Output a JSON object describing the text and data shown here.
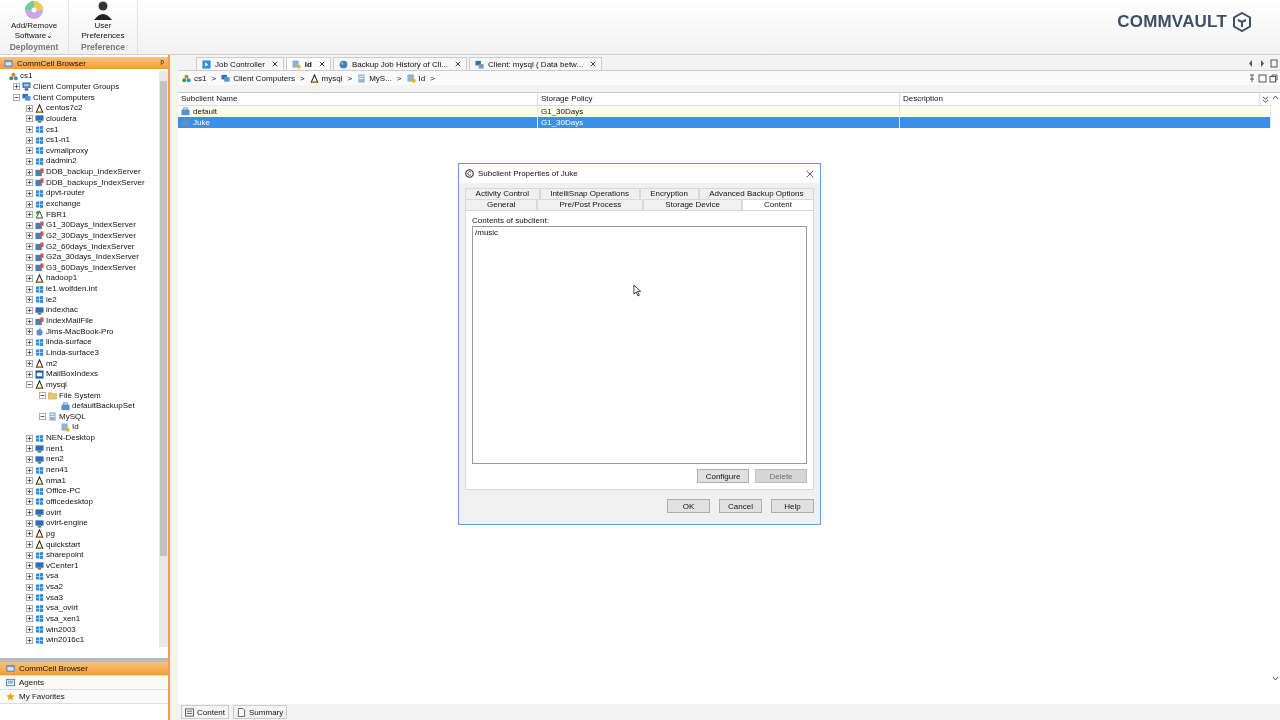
{
  "ribbon": {
    "buttons": [
      {
        "label": "Add/Remove",
        "label2": "Software",
        "caret": "⌄",
        "kind": "disc"
      },
      {
        "label": "User",
        "label2": "Preferences",
        "kind": "user"
      }
    ],
    "groups": [
      "Deployment",
      "Preference"
    ],
    "logo": "COMMVAULT"
  },
  "browser": {
    "title": "CommCell Browser",
    "pin": "ᵖ",
    "tree": [
      {
        "label": "cs1",
        "kind": "root",
        "children": [
          {
            "label": "Client Computer Groups",
            "kind": "groups",
            "expanded": false
          },
          {
            "label": "Client Computers",
            "kind": "computers",
            "expanded": true,
            "children": [
              {
                "label": "centos7c2",
                "kind": "linux",
                "expanded": false
              },
              {
                "label": "cloudera",
                "kind": "monitor",
                "expanded": false
              },
              {
                "label": "cs1",
                "kind": "windows",
                "expanded": false
              },
              {
                "label": "cs1-n1",
                "kind": "windows",
                "expanded": false
              },
              {
                "label": "cvmailproxy",
                "kind": "windows",
                "expanded": false
              },
              {
                "label": "dadmin2",
                "kind": "windows",
                "expanded": false
              },
              {
                "label": "DDB_backup_IndexServer",
                "kind": "server",
                "expanded": false
              },
              {
                "label": "DDB_backups_IndexServer",
                "kind": "server",
                "expanded": false
              },
              {
                "label": "dpvt-router",
                "kind": "windows",
                "expanded": false
              },
              {
                "label": "exchange",
                "kind": "windows",
                "expanded": false
              },
              {
                "label": "FBR1",
                "kind": "fbr",
                "expanded": false
              },
              {
                "label": "G1_30Days_IndexServer",
                "kind": "server",
                "expanded": false
              },
              {
                "label": "G2_30Days_IndexServer",
                "kind": "server",
                "expanded": false
              },
              {
                "label": "G2_60days_IndexServer",
                "kind": "server",
                "expanded": false
              },
              {
                "label": "G2a_30days_IndexServer",
                "kind": "server",
                "expanded": false
              },
              {
                "label": "G3_60Days_IndexServer",
                "kind": "server",
                "expanded": false
              },
              {
                "label": "hadoop1",
                "kind": "linux",
                "expanded": false
              },
              {
                "label": "ie1.wolfden.int",
                "kind": "windows",
                "expanded": false
              },
              {
                "label": "ie2",
                "kind": "windows",
                "expanded": false
              },
              {
                "label": "indexhac",
                "kind": "monitor",
                "expanded": false
              },
              {
                "label": "IndexMailFile",
                "kind": "server",
                "expanded": false
              },
              {
                "label": "Jims-MacBook-Pro",
                "kind": "mac",
                "expanded": false
              },
              {
                "label": "linda-surface",
                "kind": "windows",
                "expanded": false
              },
              {
                "label": "Linda-surface3",
                "kind": "windows",
                "expanded": false
              },
              {
                "label": "m2",
                "kind": "linux",
                "expanded": false
              },
              {
                "label": "MailBoxIndexs",
                "kind": "mail",
                "expanded": false
              },
              {
                "label": "mysql",
                "kind": "linux",
                "expanded": true,
                "children": [
                  {
                    "label": "File System",
                    "kind": "folder",
                    "expanded": true,
                    "children": [
                      {
                        "label": "defaultBackupSet",
                        "kind": "backupset"
                      }
                    ]
                  },
                  {
                    "label": "MySQL",
                    "kind": "db",
                    "expanded": true,
                    "children": [
                      {
                        "label": "Id",
                        "kind": "subclient"
                      }
                    ]
                  }
                ]
              },
              {
                "label": "NEN-Desktop",
                "kind": "windows",
                "expanded": false
              },
              {
                "label": "nen1",
                "kind": "monitor",
                "expanded": false
              },
              {
                "label": "nen2",
                "kind": "monitor",
                "expanded": false
              },
              {
                "label": "nen41",
                "kind": "windows",
                "expanded": false
              },
              {
                "label": "nma1",
                "kind": "linux",
                "expanded": false
              },
              {
                "label": "Office-PC",
                "kind": "windows",
                "expanded": false
              },
              {
                "label": "officedesktop",
                "kind": "windows",
                "expanded": false
              },
              {
                "label": "ovirt",
                "kind": "monitor",
                "expanded": false
              },
              {
                "label": "ovirt-engine",
                "kind": "monitor",
                "expanded": false
              },
              {
                "label": "pg",
                "kind": "linux",
                "expanded": false
              },
              {
                "label": "quickstart",
                "kind": "linux",
                "expanded": false
              },
              {
                "label": "sharepoint",
                "kind": "windows",
                "expanded": false
              },
              {
                "label": "vCenter1",
                "kind": "monitor",
                "expanded": false
              },
              {
                "label": "vsa",
                "kind": "windows",
                "expanded": false
              },
              {
                "label": "vsa2",
                "kind": "windows",
                "expanded": false
              },
              {
                "label": "vsa3",
                "kind": "windows",
                "expanded": false
              },
              {
                "label": "vsa_ovirt",
                "kind": "windows",
                "expanded": false
              },
              {
                "label": "vsa_xen1",
                "kind": "windows",
                "expanded": false
              },
              {
                "label": "win2003",
                "kind": "windows",
                "expanded": false
              },
              {
                "label": "win2016c1",
                "kind": "windows",
                "expanded": false
              }
            ]
          }
        ]
      }
    ]
  },
  "nav": [
    {
      "label": "CommCell Browser",
      "kind": "browser",
      "selected": true
    },
    {
      "label": "Agents",
      "kind": "agents",
      "selected": false
    },
    {
      "label": "My Favorites",
      "kind": "star",
      "selected": false
    }
  ],
  "tabs": [
    {
      "label": "Job Controller",
      "kind": "play",
      "selected": false
    },
    {
      "label": "Id",
      "kind": "subclient",
      "selected": true
    },
    {
      "label": "Backup Job History of Cli...",
      "kind": "history",
      "selected": false
    },
    {
      "label": "Client: mysql ( Data betw...",
      "kind": "client",
      "selected": false
    }
  ],
  "breadcrumb": [
    {
      "label": "cs1",
      "kind": "root",
      "sep": ">"
    },
    {
      "label": "Client Computers",
      "kind": "computers",
      "sep": ">"
    },
    {
      "label": "mysql",
      "kind": "linux",
      "sep": ">"
    },
    {
      "label": "MyS...",
      "kind": "db",
      "sep": ">"
    },
    {
      "label": "Id",
      "kind": "subclient",
      "sep": ">"
    }
  ],
  "table": {
    "columns": [
      "Subclient Name",
      "Storage Policy",
      "Description"
    ],
    "rows": [
      {
        "cells": [
          "default",
          "G1_30Days",
          ""
        ],
        "selected": false
      },
      {
        "cells": [
          "Juke",
          "G1_30Days",
          ""
        ],
        "selected": true
      }
    ]
  },
  "dialog": {
    "title": "Subclient Properties of Juke",
    "tab_rows": [
      [
        {
          "label": "Activity Control",
          "selected": false
        },
        {
          "label": "IntelliSnap Operations",
          "selected": false
        },
        {
          "label": "Encryption",
          "selected": false
        },
        {
          "label": "Advanced Backup Options",
          "selected": false
        }
      ],
      [
        {
          "label": "General",
          "selected": false
        },
        {
          "label": "Pre/Post Process",
          "selected": false
        },
        {
          "label": "Storage Device",
          "selected": false
        },
        {
          "label": "Content",
          "selected": true
        }
      ]
    ],
    "content_label": "Contents of subclient:",
    "contents": [
      "/music"
    ],
    "list_buttons": [
      {
        "label": "Configure",
        "disabled": false
      },
      {
        "label": "Delete",
        "disabled": true
      }
    ],
    "buttons": [
      "OK",
      "Cancel",
      "Help"
    ]
  },
  "bottom_tabs": [
    {
      "label": "Content",
      "kind": "content"
    },
    {
      "label": "Summary",
      "kind": "summary"
    }
  ]
}
